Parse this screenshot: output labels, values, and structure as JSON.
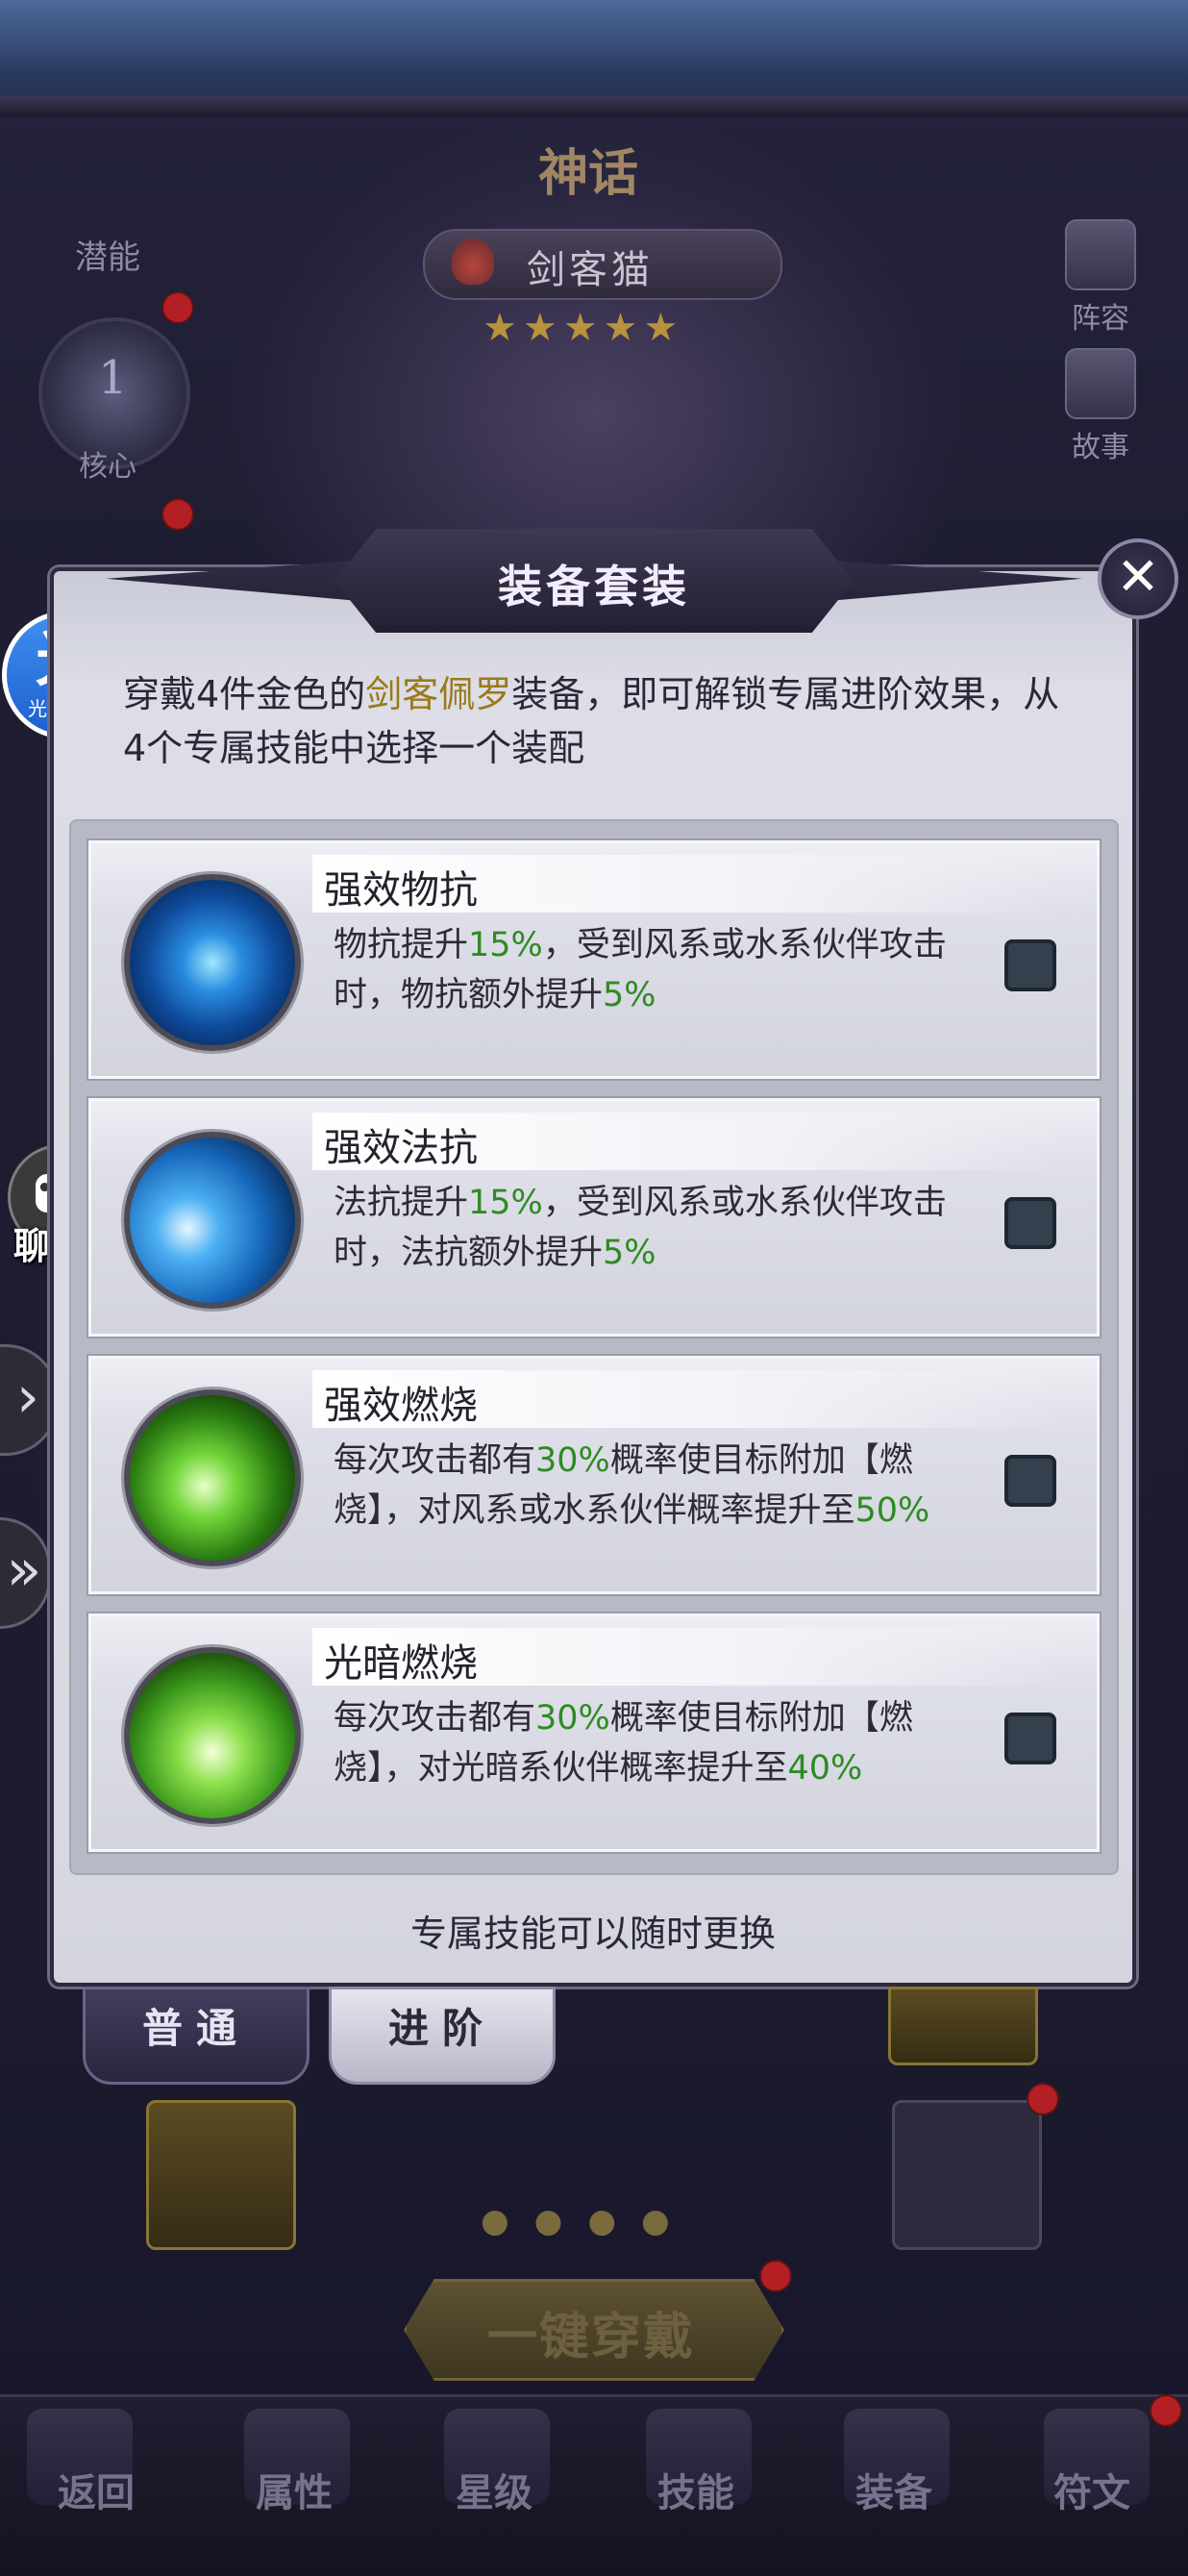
{
  "background": {
    "title": "神话",
    "potential_label": "潜能",
    "hero_name": "剑客猫",
    "stars": "★★★★★",
    "core_number": "1",
    "core_label": "核心",
    "side_buttons": [
      "阵容",
      "故事"
    ]
  },
  "floating": {
    "assistant_big": "光",
    "assistant_small": "光环助手",
    "chat_bubble": "•••",
    "chat_label": "聊天",
    "arrow_1": "›",
    "arrow_2": "»"
  },
  "modal": {
    "title": "装备套装",
    "close_icon": "✕",
    "intro_prefix": "穿戴4件金色的",
    "intro_highlight": "剑客佩罗",
    "intro_suffix": "装备，即可解锁专属进阶效果，从4个专属技能中选择一个装配",
    "options": [
      {
        "name": "强效物抗",
        "icon": "blue-orb-icon",
        "desc": [
          {
            "t": "物抗提升",
            "h": false
          },
          {
            "t": "15%",
            "h": true
          },
          {
            "t": "，受到风系或水系伙伴攻击时，物抗额外提升",
            "h": false
          },
          {
            "t": "5%",
            "h": true
          }
        ],
        "checked": false
      },
      {
        "name": "强效法抗",
        "icon": "blue-slash-icon",
        "desc": [
          {
            "t": "法抗提升",
            "h": false
          },
          {
            "t": "15%",
            "h": true
          },
          {
            "t": "，受到风系或水系伙伴攻击时，法抗额外提升",
            "h": false
          },
          {
            "t": "5%",
            "h": true
          }
        ],
        "checked": false
      },
      {
        "name": "强效燃烧",
        "icon": "green-spike-icon",
        "desc": [
          {
            "t": "每次攻击都有",
            "h": false
          },
          {
            "t": "30%",
            "h": true
          },
          {
            "t": "概率使目标附加【燃烧】，对风系或水系伙伴概率提升至",
            "h": false
          },
          {
            "t": "50%",
            "h": true
          }
        ],
        "checked": false
      },
      {
        "name": "光暗燃烧",
        "icon": "green-burst-icon",
        "desc": [
          {
            "t": "每次攻击都有",
            "h": false
          },
          {
            "t": "30%",
            "h": true
          },
          {
            "t": "概率使目标附加【燃烧】，对光暗系伙伴概率提升至",
            "h": false
          },
          {
            "t": "40%",
            "h": true
          }
        ],
        "checked": false
      }
    ],
    "footer": "专属技能可以随时更换"
  },
  "tabs": {
    "normal": "普通",
    "advanced": "进阶"
  },
  "wear_all": "一键穿戴",
  "nav": {
    "back": "返回",
    "attributes": "属性",
    "stars": "星级",
    "skills": "技能",
    "equipment": "装备",
    "runes": "符文"
  },
  "colors": {
    "highlight_green": "#2e8b22",
    "highlight_gold": "#9a7a18",
    "red_dot": "#b31f22"
  }
}
